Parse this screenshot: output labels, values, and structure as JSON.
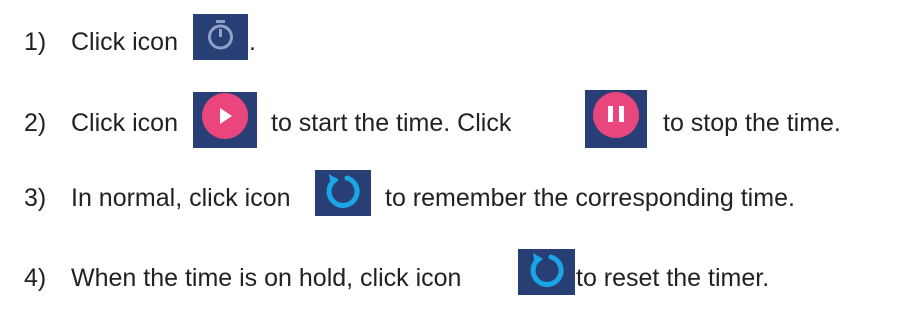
{
  "steps": [
    {
      "number": "1)",
      "text_before": "Click icon",
      "icon": "stopwatch-icon",
      "text_after": "."
    },
    {
      "number": "2)",
      "text_before": "Click icon",
      "icon": "play-icon",
      "text_middle": "to start the time. Click",
      "icon_2": "pause-icon",
      "text_after": "to stop the time."
    },
    {
      "number": "3)",
      "text_before": "In normal, click icon",
      "icon": "refresh-icon",
      "text_after": "to remember the corresponding time."
    },
    {
      "number": "4)",
      "text_before": "When the time is on hold, click icon",
      "icon": "refresh-icon",
      "text_after": "to reset the timer."
    }
  ],
  "colors": {
    "icon_background": "#283f75",
    "button_pink": "#e8467c",
    "refresh_blue": "#1aa6e6",
    "stopwatch_stroke": "#8fa2c6"
  }
}
